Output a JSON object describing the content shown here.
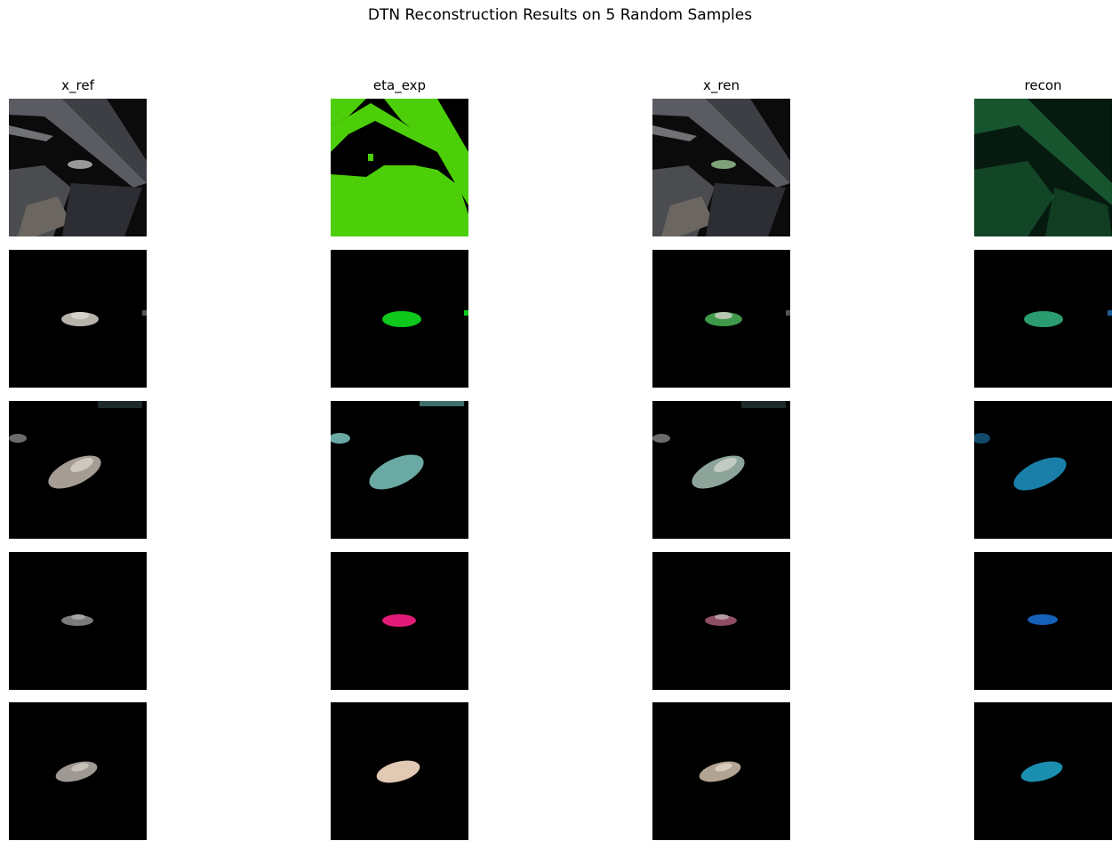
{
  "figure": {
    "title": "DTN Reconstruction Results on 5 Random Samples",
    "columns": [
      "x_ref",
      "eta_exp",
      "x_ren",
      "recon"
    ]
  },
  "samples": [
    {
      "mask_color": "#4ccf09",
      "recon_color": "#1e6a3a"
    },
    {
      "mask_color": "#0ec91c",
      "recon_color": "#2a9c70"
    },
    {
      "mask_color": "#6aa9a4",
      "recon_color": "#1a7fa8"
    },
    {
      "mask_color": "#e21a78",
      "recon_color": "#1560b8"
    },
    {
      "mask_color": "#e2c9b4",
      "recon_color": "#1a8fb0"
    }
  ]
}
